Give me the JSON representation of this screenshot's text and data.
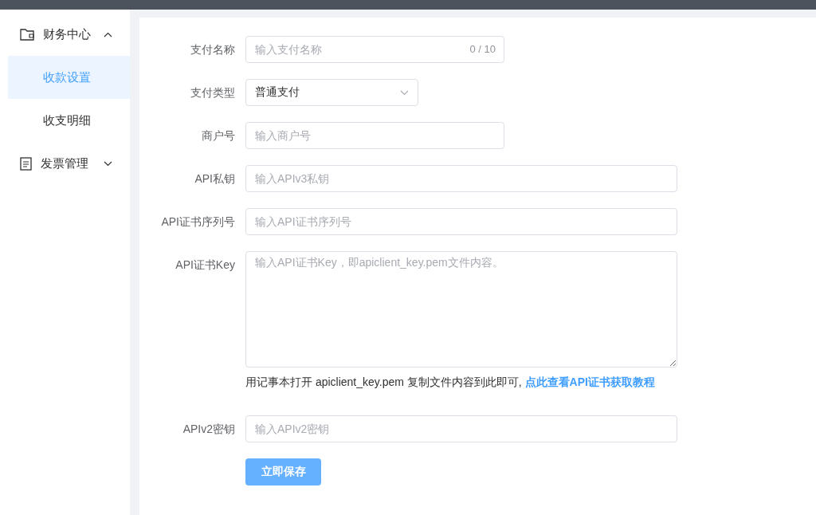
{
  "sidebar": {
    "items": [
      {
        "label": "财务中心",
        "kind": "wallet",
        "expanded": true,
        "children": [
          {
            "label": "收款设置",
            "selected": true
          },
          {
            "label": "收支明细",
            "selected": false
          }
        ]
      },
      {
        "label": "发票管理",
        "kind": "document",
        "expanded": false
      }
    ]
  },
  "form": {
    "fields": [
      {
        "kind": "input",
        "label": "支付名称",
        "placeholder": "输入支付名称",
        "counter": "0 / 10"
      },
      {
        "kind": "select",
        "label": "支付类型",
        "value": "普通支付"
      },
      {
        "kind": "input",
        "label": "商户号",
        "placeholder": "输入商户号"
      },
      {
        "kind": "input",
        "label": "API私钥",
        "placeholder": "输入APIv3私钥"
      },
      {
        "kind": "input",
        "label": "API证书序列号",
        "placeholder": "输入API证书序列号"
      },
      {
        "kind": "textarea",
        "label": "API证书Key",
        "placeholder": "输入API证书Key，即apiclient_key.pem文件内容。",
        "hint": "用记事本打开 apiclient_key.pem 复制文件内容到此即可, ",
        "hint_link": "点此查看API证书获取教程"
      },
      {
        "kind": "input",
        "label": "APIv2密钥",
        "placeholder": "输入APIv2密钥"
      }
    ],
    "submit": "立即保存"
  }
}
